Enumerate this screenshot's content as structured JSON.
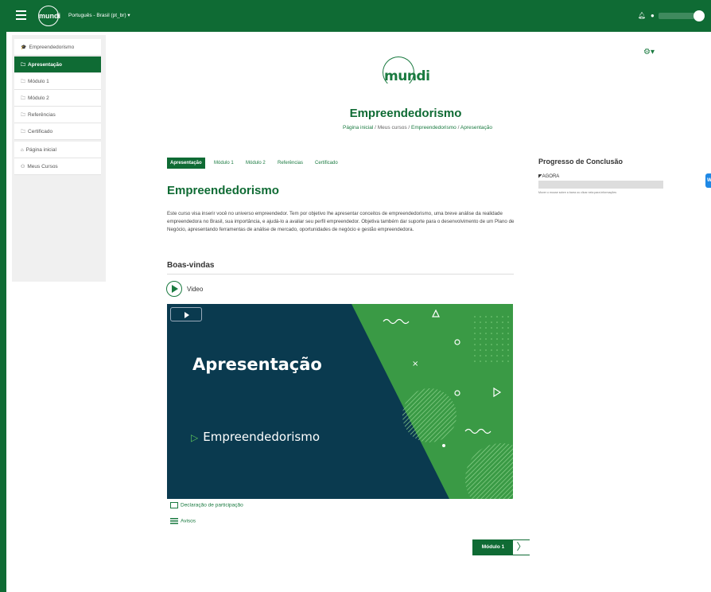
{
  "navbar": {
    "logo_text": "mundi",
    "language": "Português - Brasil (pt_br) ▾",
    "bell_icon": "bell-icon",
    "chat_icon": "chat-icon",
    "menu_icon": "hamburger-icon"
  },
  "sidebar": {
    "items": [
      {
        "icon": "🎓",
        "label": "Empreendedorismo"
      },
      {
        "icon": "🗀",
        "label": "Apresentação"
      },
      {
        "icon": "🗀",
        "label": "Módulo 1"
      },
      {
        "icon": "🗀",
        "label": "Módulo 2"
      },
      {
        "icon": "🗀",
        "label": "Referências"
      },
      {
        "icon": "🗀",
        "label": "Certificado"
      },
      {
        "icon": "⌂",
        "label": "Página inicial"
      },
      {
        "icon": "⚇",
        "label": "Meus Cursos"
      }
    ]
  },
  "header": {
    "logo_text": "mundi",
    "title": "Empreendedorismo",
    "breadcrumb": {
      "home": "Página inicial",
      "courses": "Meus cursos",
      "course": "Empreendedorismo",
      "current": "Apresentação",
      "sep": "/"
    }
  },
  "tabs": [
    "Apresentação",
    "Módulo 1",
    "Módulo 2",
    "Referências",
    "Certificado"
  ],
  "content": {
    "section_title": "Empreendedorismo",
    "intro": "Este curso visa inserir você no universo empreendedor. Tem por objetivo lhe apresentar conceitos de empreendedorismo, uma breve análise da realidade empreendedora no Brasil, sua importância, e ajudá-lo a avaliar seu perfil empreendedor. Objetiva também dar suporte para o desenvolvimento de um Plano de Negócio, apresentando ferramentas de análise de mercado, oportunidades de negócio e gestão empreendedora.",
    "welcome": "Boas-vindas",
    "video_label": "Video",
    "video": {
      "title": "Apresentação",
      "subtitle": "Empreendedorismo"
    },
    "links": [
      {
        "icon": "certificate-icon",
        "label": "Declaração de participação"
      },
      {
        "icon": "forum-icon",
        "label": "Avisos"
      }
    ],
    "next_button": "Módulo 1"
  },
  "progress": {
    "title": "Progresso de Conclusão",
    "label": "AGORA",
    "value": 0,
    "hint": "Mover o mouse sobre a barra ou clicar nela para informações"
  },
  "colors": {
    "brand": "#0f6b34",
    "accent": "#1a7a40",
    "video_bg": "#0a3a4f",
    "video_green": "#3a9a45"
  }
}
